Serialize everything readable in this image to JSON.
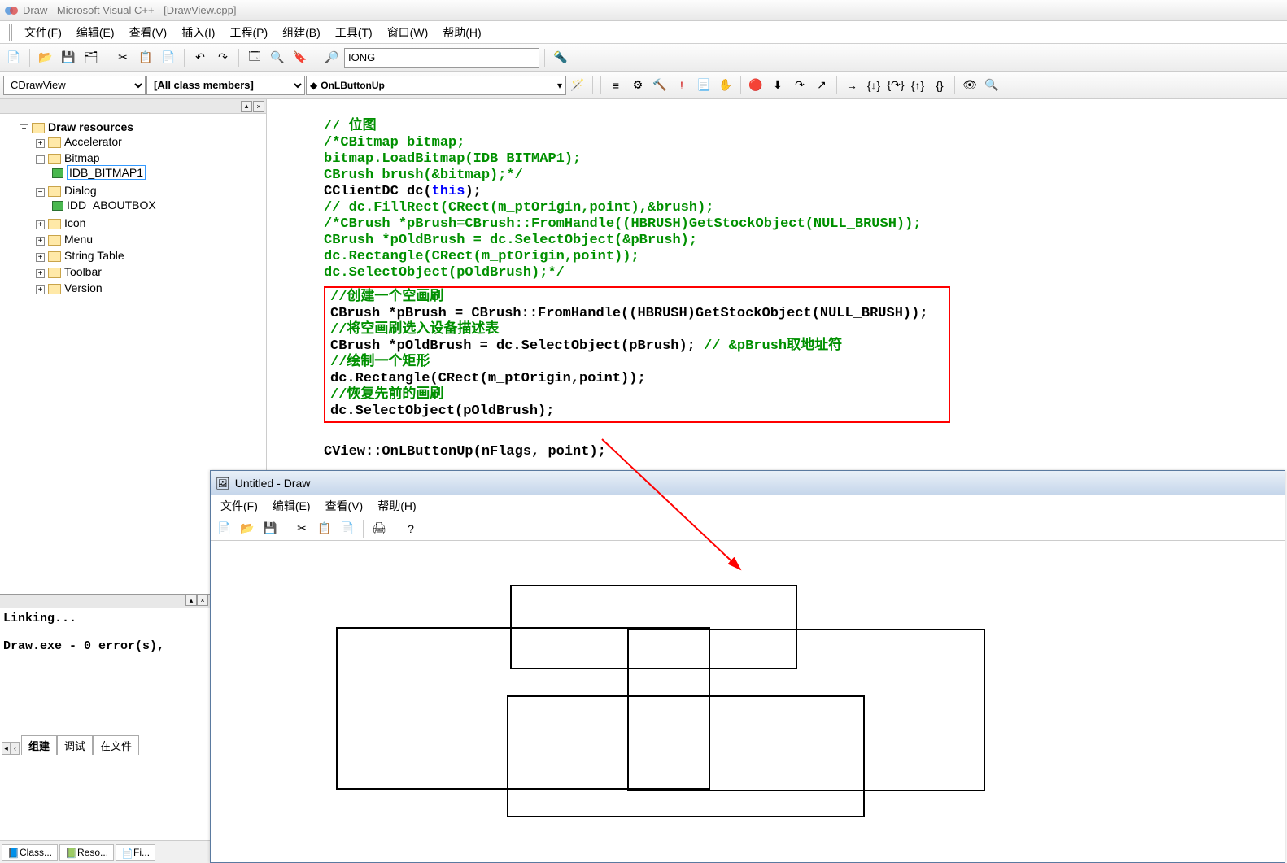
{
  "title": "Draw - Microsoft Visual C++ - [DrawView.cpp]",
  "menus": {
    "file": "文件(F)",
    "edit": "编辑(E)",
    "view": "查看(V)",
    "insert": "插入(I)",
    "project": "工程(P)",
    "build": "组建(B)",
    "tools": "工具(T)",
    "window": "窗口(W)",
    "help": "帮助(H)"
  },
  "toolbar": {
    "find_text": "IONG"
  },
  "combo": {
    "class": "CDrawView",
    "members": "[All class members]",
    "function": "OnLButtonUp"
  },
  "tree": {
    "root": "Draw resources",
    "accelerator": "Accelerator",
    "bitmap": "Bitmap",
    "idb_bitmap1": "IDB_BITMAP1",
    "dialog": "Dialog",
    "idd_aboutbox": "IDD_ABOUTBOX",
    "icon": "Icon",
    "menu": "Menu",
    "string_table": "String Table",
    "toolbar": "Toolbar",
    "version": "Version"
  },
  "bottom_tabs": {
    "class": "Class...",
    "reso": "Reso...",
    "fi": "Fi..."
  },
  "code": {
    "l1": "// 位图",
    "l2": "/*CBitmap bitmap;",
    "l3": "bitmap.LoadBitmap(IDB_BITMAP1);",
    "l4": "CBrush brush(&bitmap);*/",
    "l5a": "CClientDC dc(",
    "l5b": "this",
    "l5c": ");",
    "l6": "// dc.FillRect(CRect(m_ptOrigin,point),&brush);",
    "l7": "/*CBrush *pBrush=CBrush::FromHandle((HBRUSH)GetStockObject(NULL_BRUSH));",
    "l8": "CBrush *pOldBrush = dc.SelectObject(&pBrush);",
    "l9": "dc.Rectangle(CRect(m_ptOrigin,point));",
    "l10": "dc.SelectObject(pOldBrush);*/",
    "b1": "//创建一个空画刷",
    "b2": "CBrush *pBrush = CBrush::FromHandle((HBRUSH)GetStockObject(NULL_BRUSH));",
    "b3": "//将空画刷选入设备描述表",
    "b4a": "CBrush *pOldBrush = dc.SelectObject(pBrush); ",
    "b4b": "// &pBrush取地址符",
    "b5": "//绘制一个矩形",
    "b6": "dc.Rectangle(CRect(m_ptOrigin,point));",
    "b7": "//恢复先前的画刷",
    "b8": "dc.SelectObject(pOldBrush);",
    "l_after": "CView::OnLButtonUp(nFlags, point);"
  },
  "output": {
    "linking": "Linking...",
    "result": "Draw.exe - 0 error(s),",
    "tab_build": "组建",
    "tab_debug": "调试",
    "tab_find": "在文件"
  },
  "child": {
    "title": "Untitled - Draw",
    "menu_file": "文件(F)",
    "menu_edit": "编辑(E)",
    "menu_view": "查看(V)",
    "menu_help": "帮助(H)"
  }
}
